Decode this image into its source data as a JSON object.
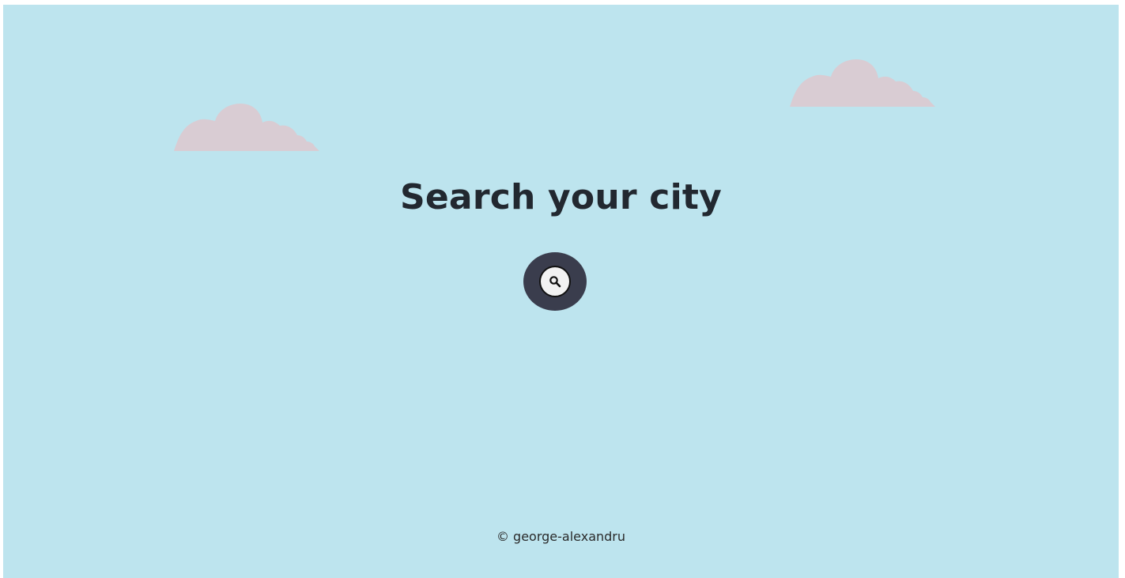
{
  "main": {
    "title": "Search your city",
    "search_button_icon": "search-icon"
  },
  "footer": {
    "credit": "© george-alexandru"
  },
  "colors": {
    "sky": "#bde4ee",
    "cloud": "#d9ccd3",
    "title": "#222830",
    "button_outer": "#3a3d4d",
    "button_inner": "#f2f2f2"
  }
}
